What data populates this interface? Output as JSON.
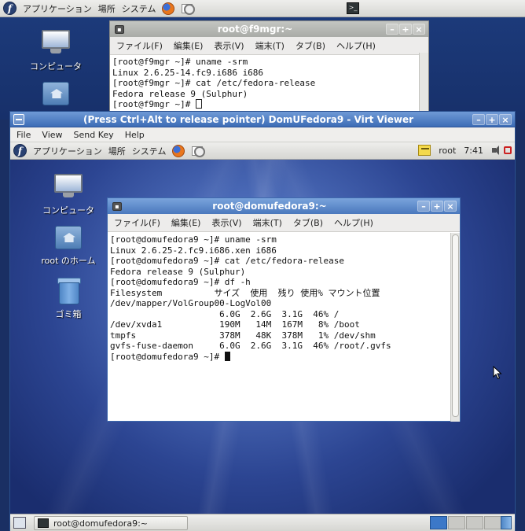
{
  "host": {
    "panel": {
      "applications": "アプリケーション",
      "places": "場所",
      "system": "システム"
    },
    "desktop": {
      "computer_label": "コンピュータ"
    },
    "terminal": {
      "title": "root@f9mgr:~",
      "menu": [
        "ファイル(F)",
        "編集(E)",
        "表示(V)",
        "端末(T)",
        "タブ(B)",
        "ヘルプ(H)"
      ],
      "lines": [
        "[root@f9mgr ~]# uname -srm",
        "Linux 2.6.25-14.fc9.i686 i686",
        "[root@f9mgr ~]# cat /etc/fedora-release",
        "Fedora release 9 (Sulphur)"
      ],
      "prompt": "[root@f9mgr ~]# "
    }
  },
  "viewer": {
    "title": "(Press Ctrl+Alt to release pointer) DomUFedora9 - Virt Viewer",
    "menu": [
      "File",
      "View",
      "Send Key",
      "Help"
    ]
  },
  "guest": {
    "panel": {
      "applications": "アプリケーション",
      "places": "場所",
      "system": "システム",
      "user": "root",
      "clock": "7:41"
    },
    "desktop": {
      "computer_label": "コンピュータ",
      "home_label": "root のホーム",
      "trash_label": "ゴミ箱"
    },
    "terminal": {
      "title": "root@domufedora9:~",
      "menu": [
        "ファイル(F)",
        "編集(E)",
        "表示(V)",
        "端末(T)",
        "タブ(B)",
        "ヘルプ(H)"
      ],
      "lines": [
        "[root@domufedora9 ~]# uname -srm",
        "Linux 2.6.25-2.fc9.i686.xen i686",
        "[root@domufedora9 ~]# cat /etc/fedora-release",
        "Fedora release 9 (Sulphur)",
        "[root@domufedora9 ~]# df -h",
        "Filesystem          サイズ  使用  残り 使用% マウント位置",
        "/dev/mapper/VolGroup00-LogVol00",
        "                     6.0G  2.6G  3.1G  46% /",
        "/dev/xvda1           190M   14M  167M   8% /boot",
        "tmpfs                378M   48K  378M   1% /dev/shm",
        "gvfs-fuse-daemon     6.0G  2.6G  3.1G  46% /root/.gvfs"
      ],
      "prompt": "[root@domufedora9 ~]# "
    },
    "taskbar": {
      "task_label": "root@domufedora9:~"
    }
  }
}
